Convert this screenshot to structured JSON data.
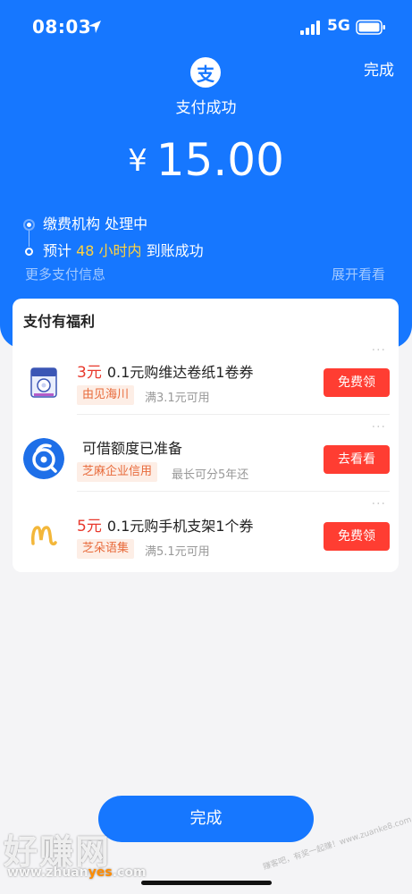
{
  "status_bar": {
    "time": "08:03",
    "network": "5G"
  },
  "header": {
    "done_label": "完成",
    "logo_char": "支",
    "title": "支付成功",
    "currency": "¥",
    "amount": "15.00"
  },
  "timeline": {
    "step1": "缴费机构 处理中",
    "step2_prefix": "预计 ",
    "step2_highlight": "48 小时内",
    "step2_suffix": " 到账成功"
  },
  "more_info": "更多支付信息",
  "expand": "展开看看",
  "benefits": {
    "title": "支付有福利",
    "items": [
      {
        "price": "3元",
        "headline": "0.1元购维达卷纸1卷券",
        "tag": "由见海川",
        "sub": "满3.1元可用",
        "cta": "免费领",
        "icon": "tissue-roll-icon"
      },
      {
        "price": "",
        "headline": "可借额度已准备",
        "tag": "芝麻企业信用",
        "sub": "最长可分5年还",
        "cta": "去看看",
        "icon": "credit-loan-icon"
      },
      {
        "price": "5元",
        "headline": "0.1元购手机支架1个券",
        "tag": "芝朵语集",
        "sub": "满5.1元可用",
        "cta": "免费领",
        "icon": "brand-m-icon"
      }
    ]
  },
  "bottom_button": "完成",
  "watermark": {
    "logo": "好赚网",
    "url_pre": "www.zhuan",
    "url_hl": "yes",
    "url_post": ".com",
    "diag": "赚客吧，有奖一起赚！www.zuanke8.com"
  },
  "colors": {
    "primary": "#1677ff",
    "accent_red": "#ff3d32",
    "highlight_yellow": "#ffd23f"
  }
}
